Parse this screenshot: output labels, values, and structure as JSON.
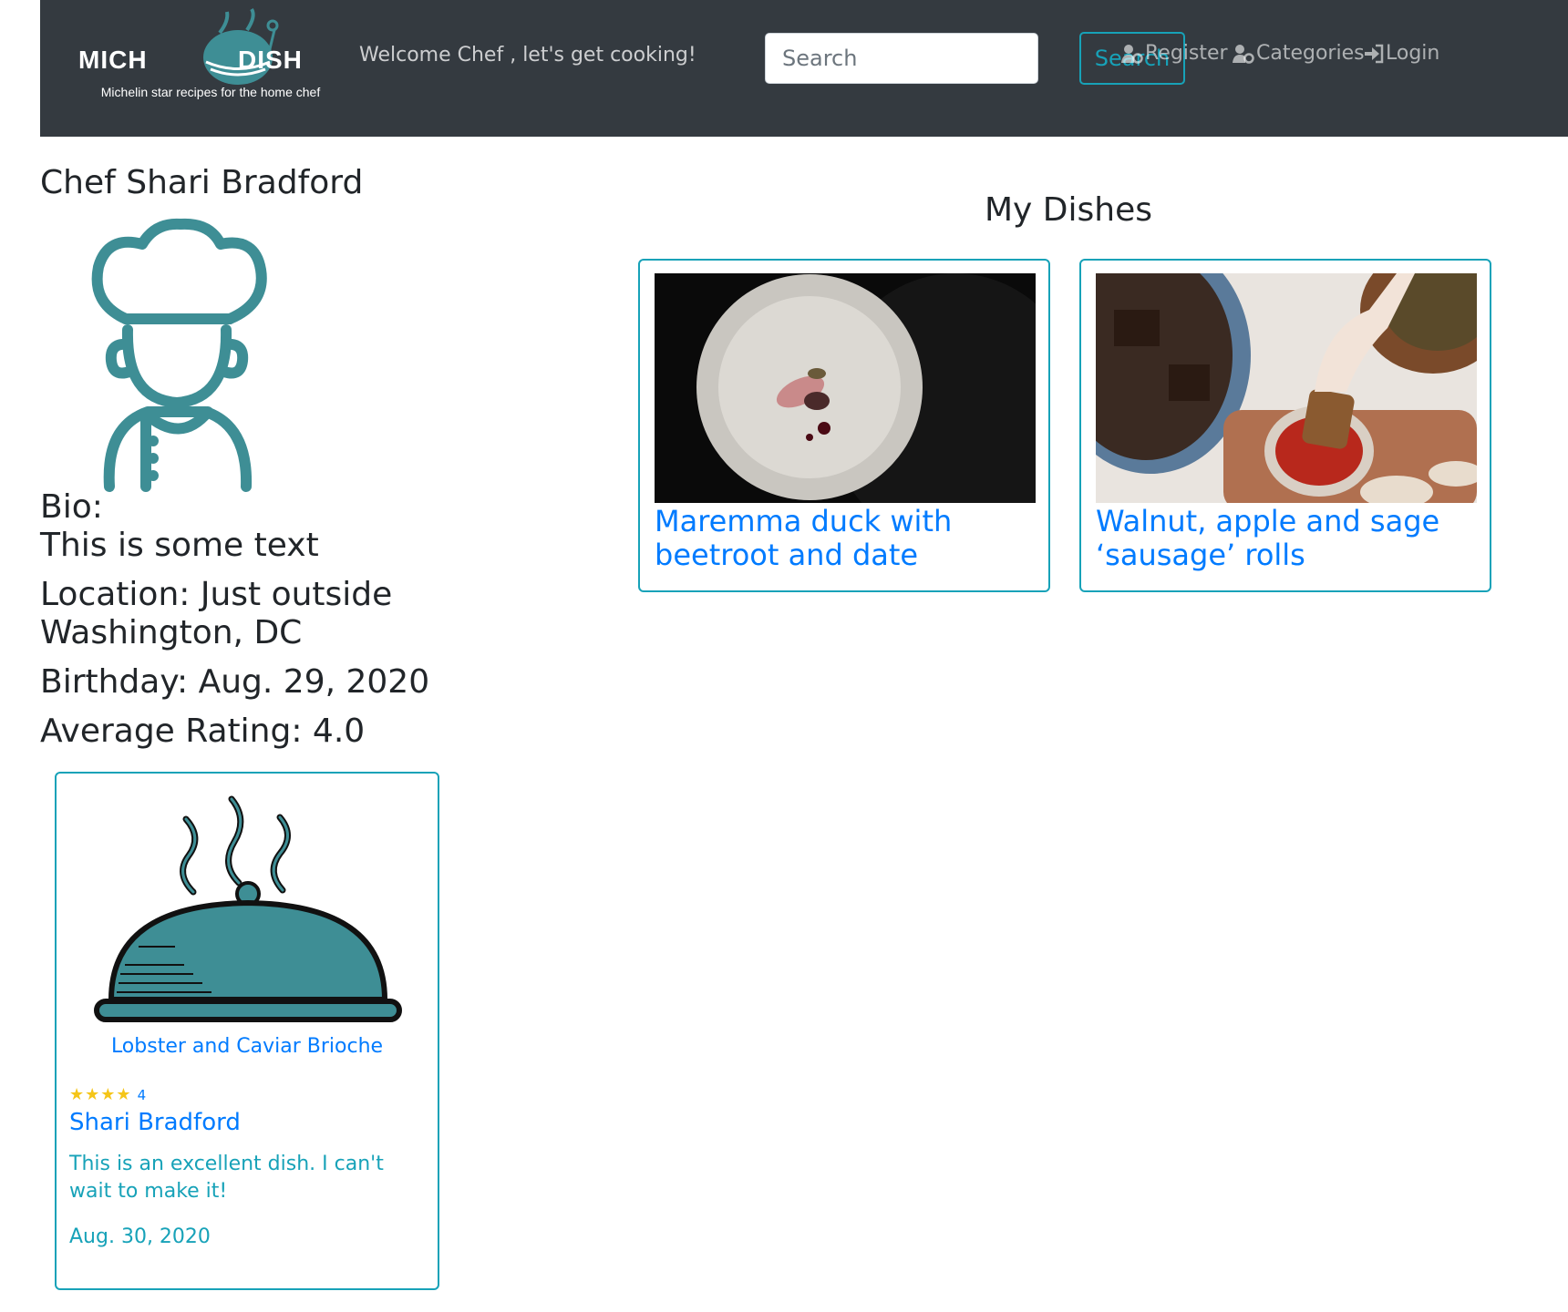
{
  "header": {
    "brand_left": "MICH",
    "brand_right": "DISH",
    "tagline": "Michelin star recipes for the home chef",
    "welcome": "Welcome Chef , let's get cooking!",
    "search_placeholder": "Search",
    "search_button": "Search",
    "links": [
      {
        "label": "Register",
        "icon": "user-cog-icon"
      },
      {
        "label": "Categories",
        "icon": "user-cog-icon"
      },
      {
        "label": "Login",
        "icon": "sign-in-icon"
      }
    ]
  },
  "profile": {
    "title": "Chef Shari Bradford",
    "avatar_icon": "chef-avatar-icon",
    "bio_label": "Bio:",
    "bio_text": "This is some text",
    "location_line1": "Location: Just outside",
    "location_line2": "Washington, DC",
    "birthday": "Birthday: Aug. 29, 2020",
    "average_rating": "Average Rating: 4.0"
  },
  "dishes": {
    "title": "My Dishes",
    "items": [
      {
        "line1": "Maremma duck with",
        "line2": "beetroot and date"
      },
      {
        "line1": "Walnut, apple and sage",
        "line2": "‘sausage’ rolls"
      }
    ]
  },
  "review": {
    "image_icon": "cloche-icon",
    "dish_name": "Lobster and Caviar Brioche",
    "rating": 4,
    "rating_text": "4",
    "reviewer": "Shari Bradford",
    "comment": "This is an excellent dish. I can't wait to make it!",
    "date": "Aug. 30, 2020"
  },
  "colors": {
    "navbar": "#343a40",
    "accent": "#17a2b8",
    "link": "#007bff",
    "teal_art": "#3e8e95",
    "star": "#f5c518"
  }
}
